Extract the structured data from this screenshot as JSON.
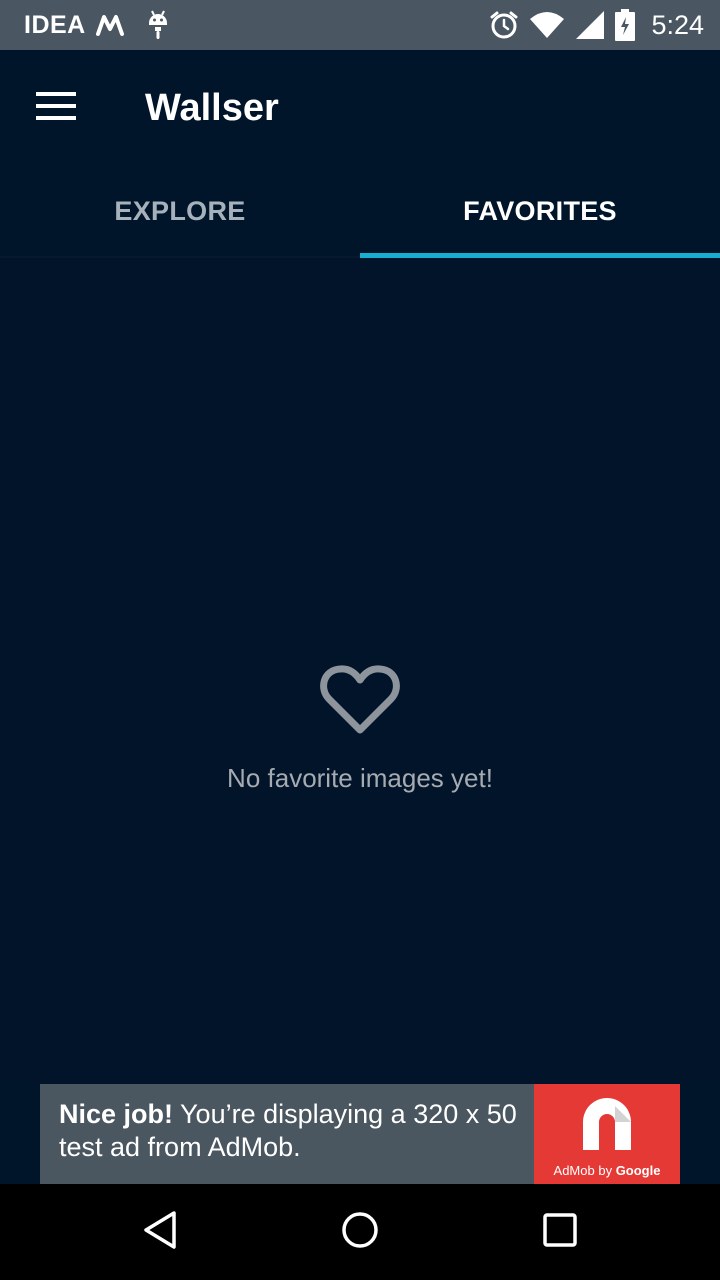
{
  "status_bar": {
    "carrier": "IDEA",
    "time": "5:24",
    "icons": [
      "m-logo-icon",
      "android-debug-icon",
      "alarm-icon",
      "wifi-icon",
      "signal-icon",
      "battery-icon"
    ]
  },
  "app_bar": {
    "title": "Wallser",
    "menu_icon": "hamburger-menu-icon"
  },
  "tabs": [
    {
      "label": "EXPLORE",
      "active": false
    },
    {
      "label": "FAVORITES",
      "active": true
    }
  ],
  "empty_state": {
    "icon": "heart-outline-icon",
    "message": "No favorite images yet!"
  },
  "ad": {
    "headline": "Nice job!",
    "body": " You’re displaying a 320 x 50 test ad from AdMob.",
    "logo_caption_prefix": "AdMob by ",
    "logo_caption_brand": "Google"
  },
  "nav_bar": {
    "icons": [
      "back-icon",
      "home-icon",
      "recents-icon"
    ]
  },
  "colors": {
    "background": "#00142a",
    "status_bar": "#4a5661",
    "accent": "#18aed0",
    "ad_red": "#e53935"
  }
}
